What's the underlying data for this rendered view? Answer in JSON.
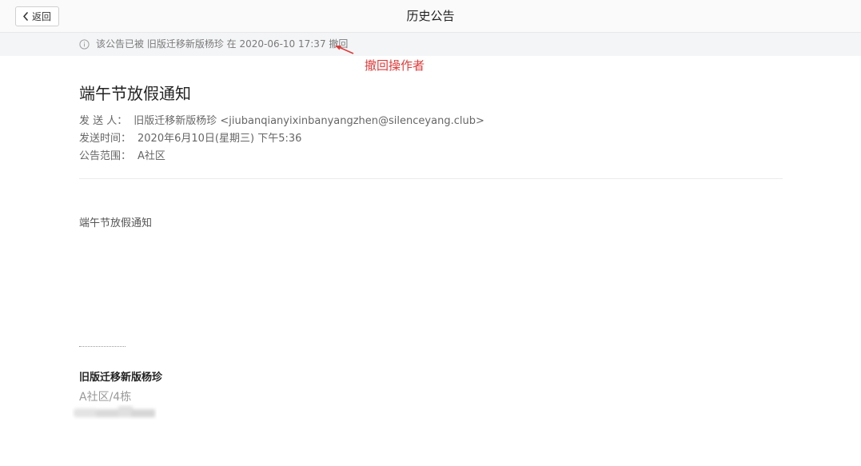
{
  "header": {
    "back_label": "返回",
    "title": "历史公告"
  },
  "notice": {
    "icon": "info-icon",
    "text": "该公告已被 旧版迁移新版杨珍 在 2020-06-10 17:37 撤回"
  },
  "annotation": {
    "label": "撤回操作者",
    "color": "#e03a3a"
  },
  "announcement": {
    "title": "端午节放假通知",
    "sender_label": "发 送 人：",
    "sender_value": "旧版迁移新版杨珍 <jiubanqianyixinbanyangzhen@silenceyang.club>",
    "time_label": "发送时间：",
    "time_value": "2020年6月10日(星期三) 下午5:36",
    "scope_label": "公告范围：",
    "scope_value": "A社区",
    "body": "端午节放假通知"
  },
  "signature": {
    "name": "旧版迁移新版杨珍",
    "department": "A社区/4栋"
  }
}
